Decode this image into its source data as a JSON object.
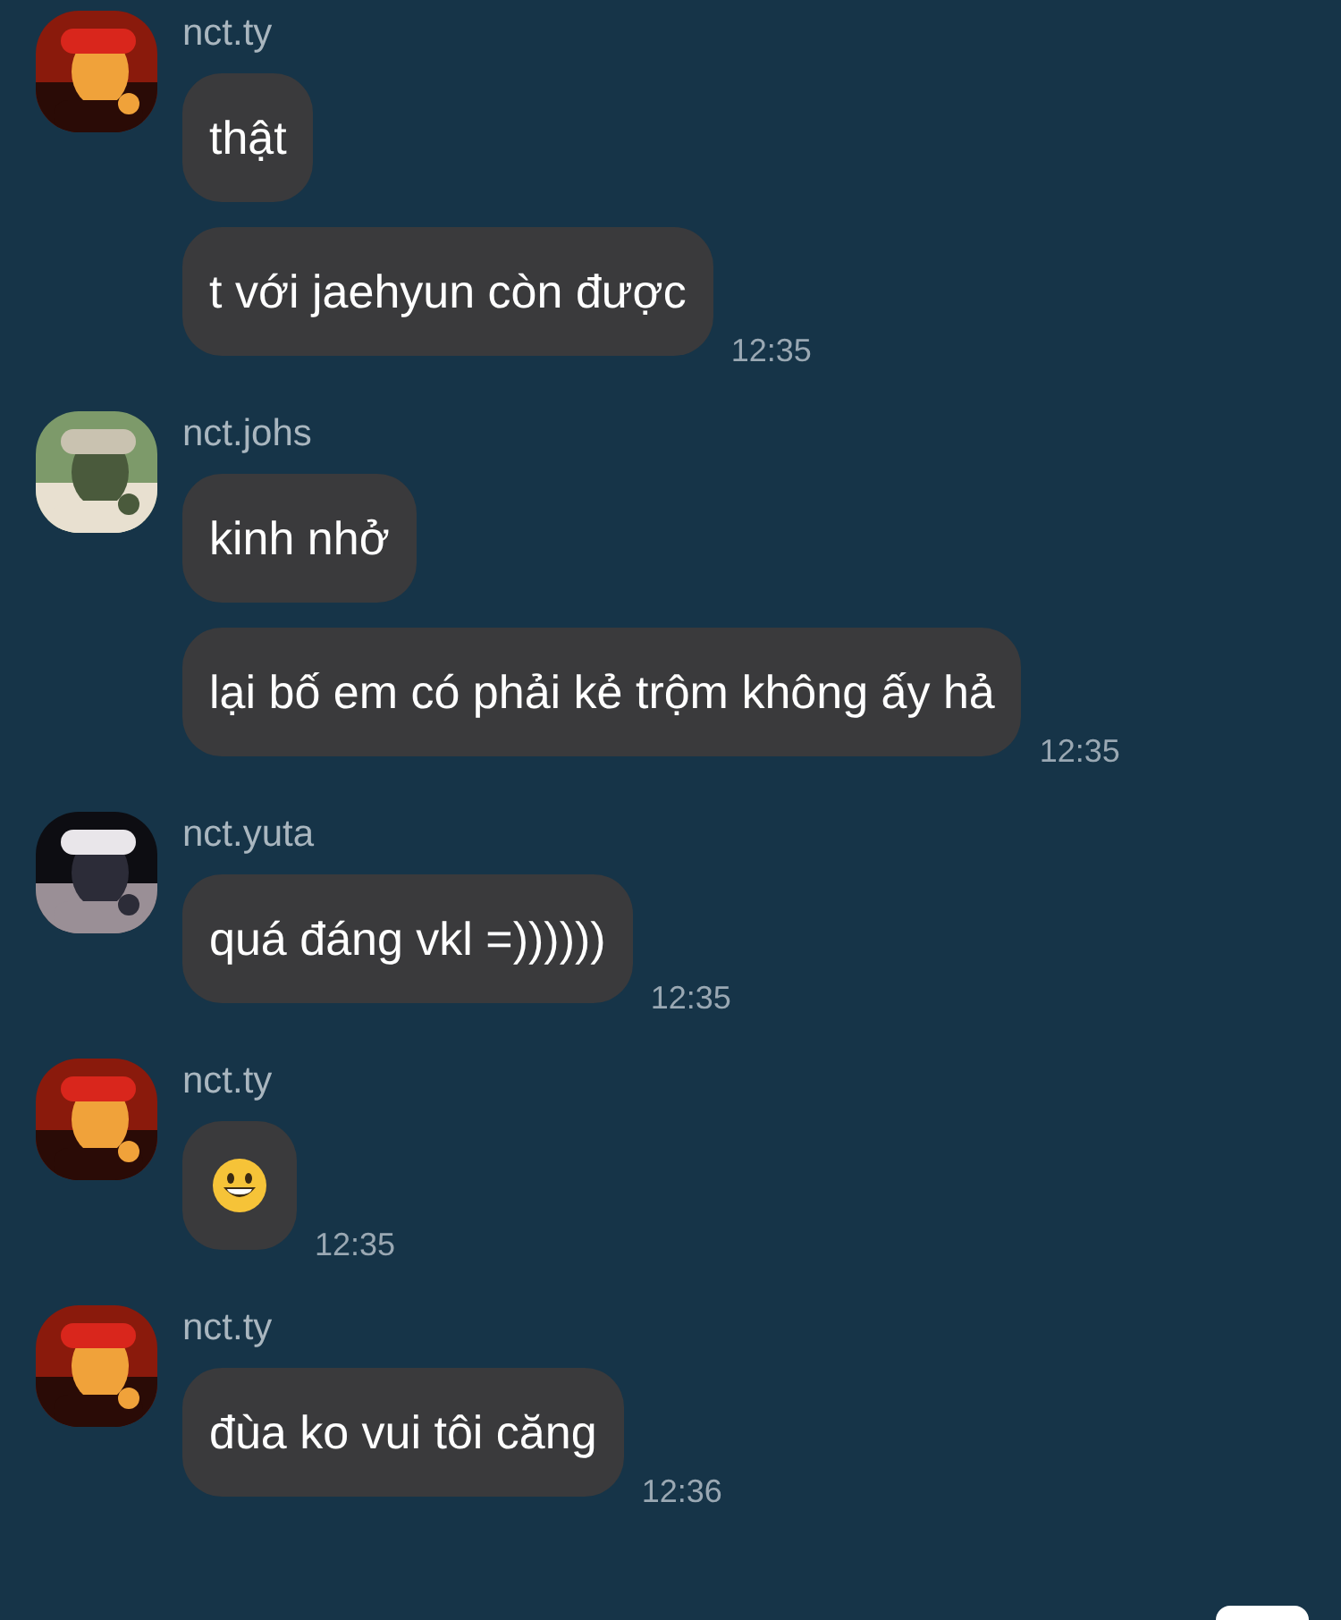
{
  "groups": [
    {
      "sender": "nct.ty",
      "avatar": {
        "kind": "picture"
      },
      "messages": [
        {
          "kind": "text",
          "text": "thật"
        },
        {
          "kind": "text",
          "text": "t với jaehyun còn được",
          "time": "12:35"
        }
      ]
    },
    {
      "sender": "nct.johs",
      "avatar": {
        "kind": "picture"
      },
      "messages": [
        {
          "kind": "text",
          "text": "kinh nhở"
        },
        {
          "kind": "text",
          "text": "lại bố em có phải kẻ trộm không ấy hả",
          "time": "12:35"
        }
      ]
    },
    {
      "sender": "nct.yuta",
      "avatar": {
        "kind": "picture"
      },
      "messages": [
        {
          "kind": "text",
          "text": "quá đáng vkl =))))))",
          "time": "12:35"
        }
      ]
    },
    {
      "sender": "nct.ty",
      "avatar": {
        "kind": "picture"
      },
      "messages": [
        {
          "kind": "emoji",
          "time": "12:35"
        }
      ]
    },
    {
      "sender": "nct.ty",
      "avatar": {
        "kind": "picture"
      },
      "messages": [
        {
          "kind": "text",
          "text": "đùa ko vui tôi căng",
          "time": "12:36"
        }
      ]
    }
  ]
}
